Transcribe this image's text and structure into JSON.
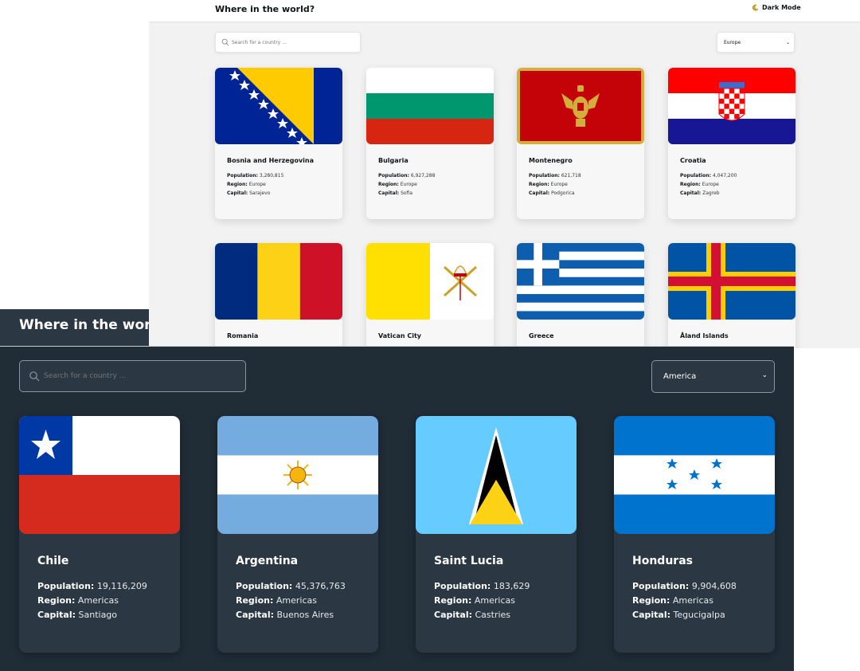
{
  "light": {
    "header": {
      "title": "Where in the world?",
      "mode_label": "Dark Mode",
      "mode_icon": "moon-icon"
    },
    "search": {
      "placeholder": "Search for a country ..."
    },
    "filter": {
      "selected": "Europe"
    },
    "labels": {
      "population": "Population:",
      "region": "Region:",
      "capital": "Capital:"
    },
    "countries": [
      {
        "name": "Bosnia and Herzegovina",
        "population": "3,280,815",
        "region": "Europe",
        "capital": "Sarajevo"
      },
      {
        "name": "Bulgaria",
        "population": "6,927,288",
        "region": "Europe",
        "capital": "Sofia"
      },
      {
        "name": "Montenegro",
        "population": "621,718",
        "region": "Europe",
        "capital": "Podgorica"
      },
      {
        "name": "Croatia",
        "population": "4,047,200",
        "region": "Europe",
        "capital": "Zagreb"
      },
      {
        "name": "Romania"
      },
      {
        "name": "Vatican City"
      },
      {
        "name": "Greece"
      },
      {
        "name": "Åland Islands"
      }
    ]
  },
  "dark": {
    "header": {
      "title": "Where in the world?"
    },
    "search": {
      "placeholder": "Search for a country ..."
    },
    "filter": {
      "selected": "America"
    },
    "labels": {
      "population": "Population:",
      "region": "Region:",
      "capital": "Capital:"
    },
    "countries": [
      {
        "name": "Chile",
        "population": "19,116,209",
        "region": "Americas",
        "capital": "Santiago"
      },
      {
        "name": "Argentina",
        "population": "45,376,763",
        "region": "Americas",
        "capital": "Buenos Aires"
      },
      {
        "name": "Saint Lucia",
        "population": "183,629",
        "region": "Americas",
        "capital": "Castries"
      },
      {
        "name": "Honduras",
        "population": "9,904,608",
        "region": "Americas",
        "capital": "Tegucigalpa"
      }
    ]
  },
  "colors": {
    "light_bg": "#f2f2f2",
    "light_card": "#f7f7f7",
    "dark_bg": "#202c36",
    "dark_element": "#2b3743",
    "text_dark": "#111517"
  }
}
